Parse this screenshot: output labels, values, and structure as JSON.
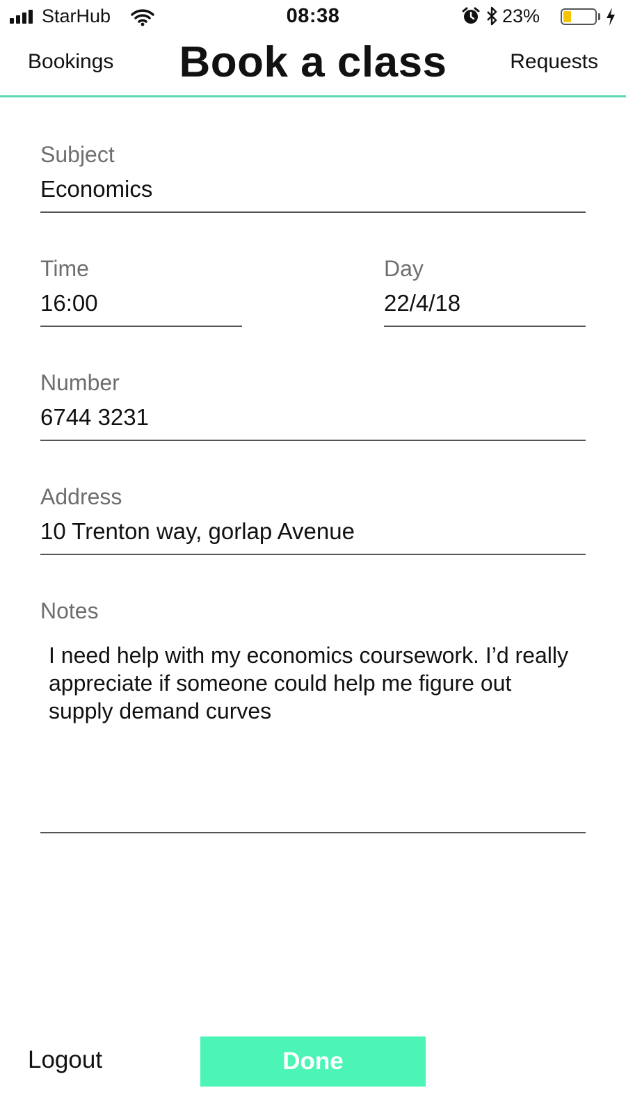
{
  "status_bar": {
    "carrier": "StarHub",
    "time": "08:38",
    "battery_percent": "23%",
    "battery_level": 0.23,
    "icons": [
      "signal-icon",
      "wifi-icon",
      "alarm-icon",
      "bluetooth-icon",
      "battery-icon",
      "charging-icon"
    ],
    "battery_color": "#f5c400"
  },
  "nav": {
    "left_label": "Bookings",
    "title": "Book a class",
    "right_label": "Requests",
    "accent_color": "#5ad8b4"
  },
  "form": {
    "subject": {
      "label": "Subject",
      "value": "Economics"
    },
    "time": {
      "label": "Time",
      "value": "16:00"
    },
    "day": {
      "label": "Day",
      "value": "22/4/18"
    },
    "number": {
      "label": "Number",
      "value": "6744 3231"
    },
    "address": {
      "label": "Address",
      "value": "10 Trenton way, gorlap Avenue"
    },
    "notes": {
      "label": "Notes",
      "value": "I need help with my economics coursework. I’d really appreciate if someone could help me figure out supply demand curves"
    }
  },
  "footer": {
    "logout_label": "Logout",
    "done_label": "Done",
    "done_color": "#4cf5b6"
  }
}
